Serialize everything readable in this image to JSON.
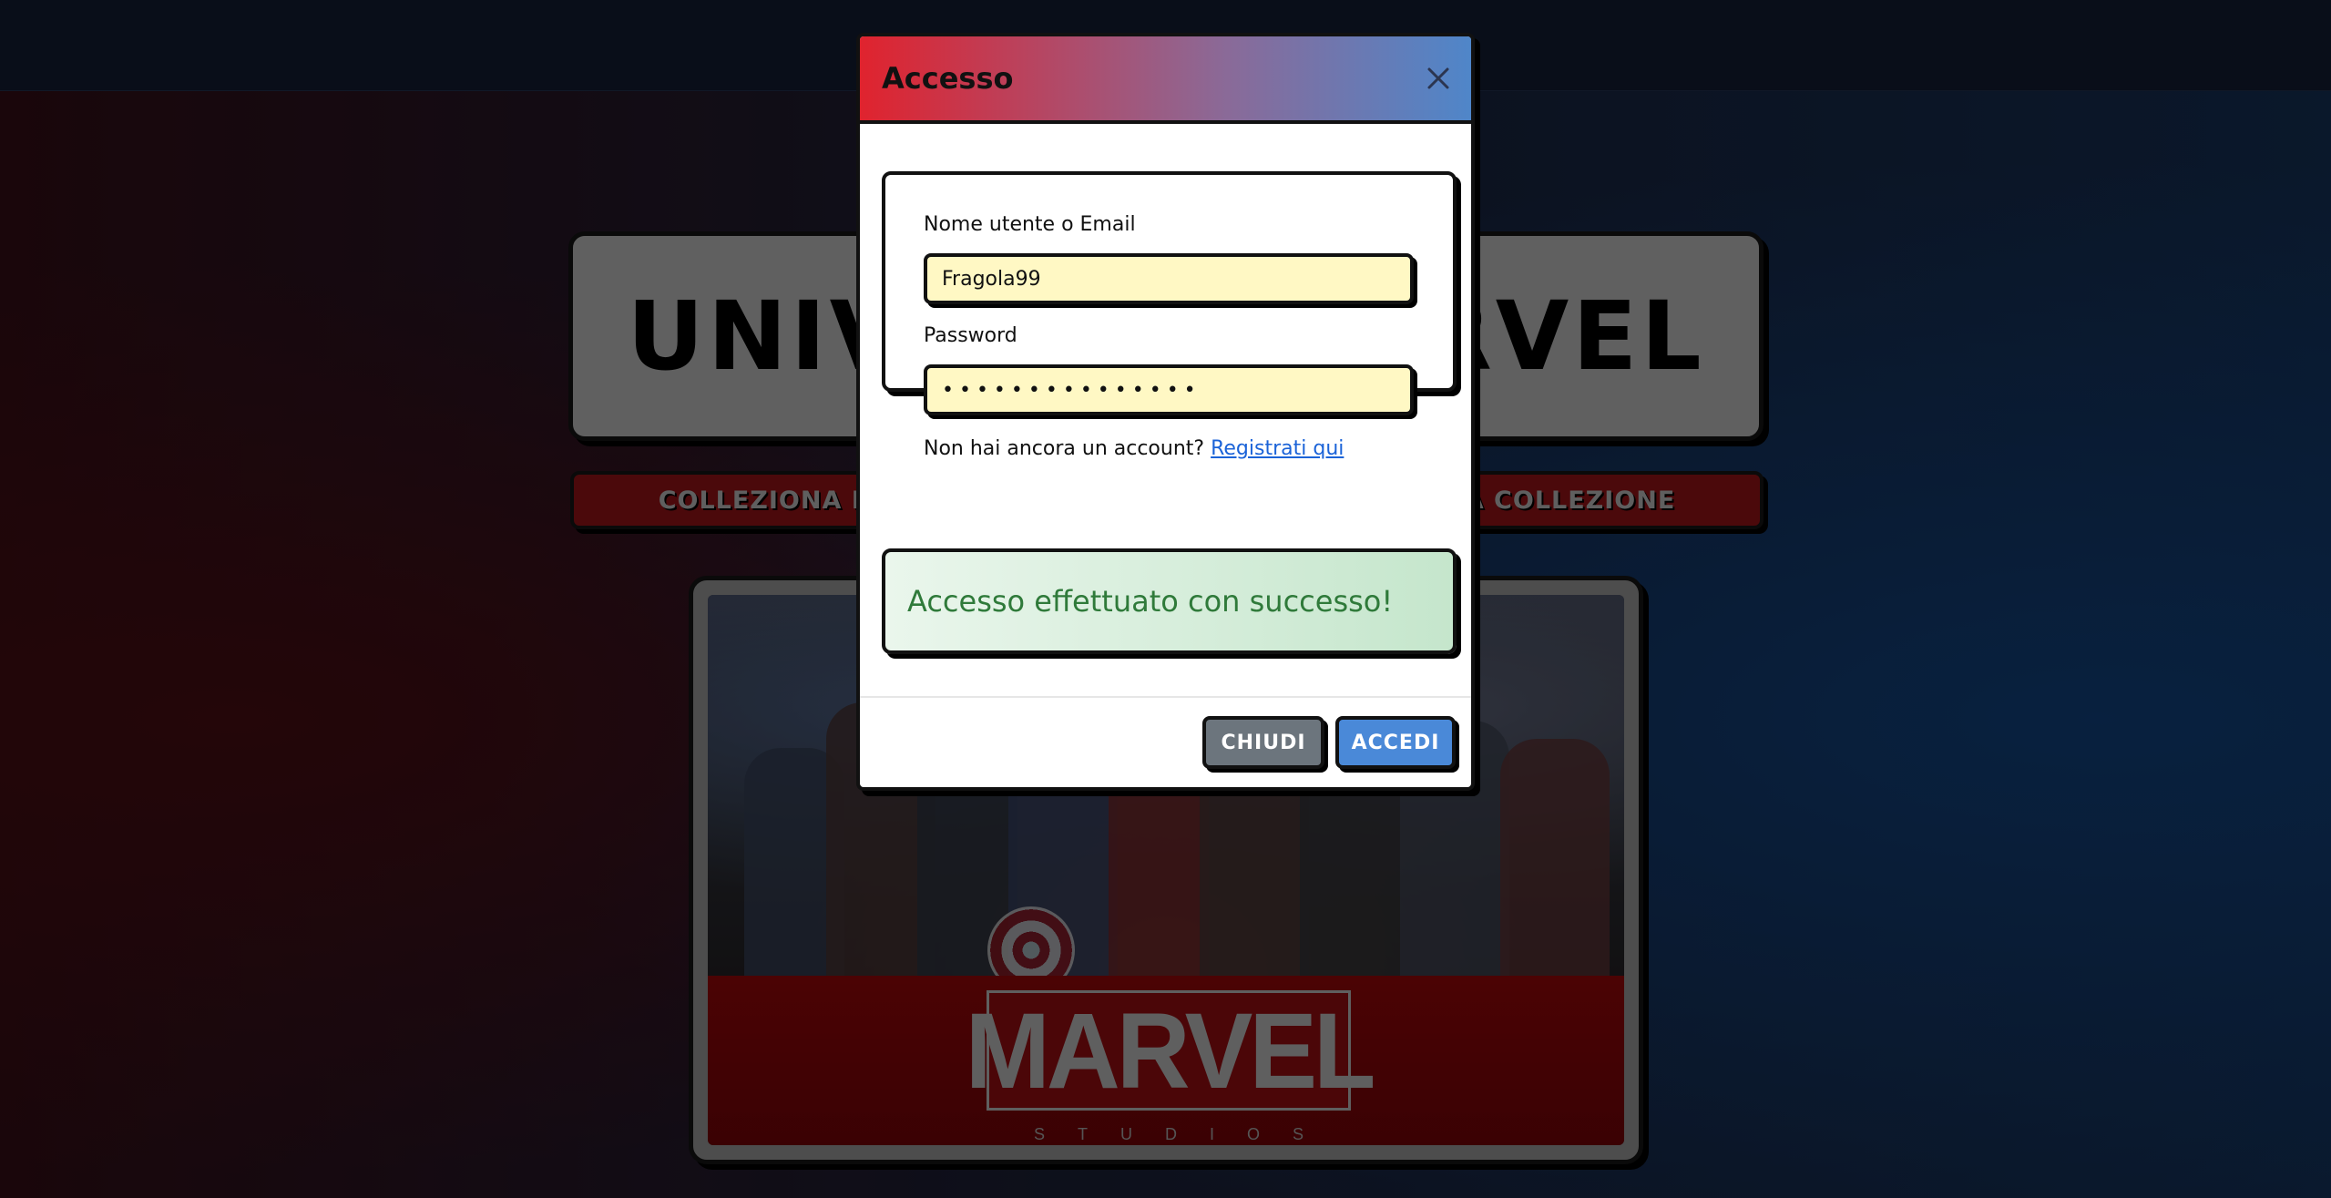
{
  "background": {
    "site_title": "UNIVERSO MARVEL",
    "tagline": "COLLEZIONA I TUOI EROI PREFERITI E COMPLETA LA TUA COLLEZIONE",
    "poster_logo": "MARVEL",
    "poster_sub": "STUDIOS"
  },
  "modal": {
    "title": "Accesso",
    "username_label": "Nome utente o Email",
    "username_value": "Fragola99",
    "password_label": "Password",
    "password_value": "•••••••••••••••",
    "register_prompt": "Non hai ancora un account?",
    "register_link": "Registrati qui",
    "success_message": "Accesso effettuato con successo!",
    "close_button": "CHIUDI",
    "login_button": "ACCEDI"
  },
  "colors": {
    "header_start": "#e0232e",
    "header_end": "#4f86c9",
    "input_bg": "#fff8c4",
    "success_text": "#2f7a3a",
    "close_btn": "#6c757d",
    "login_btn": "#4a89d8"
  },
  "icons": {
    "close": "close-icon"
  }
}
